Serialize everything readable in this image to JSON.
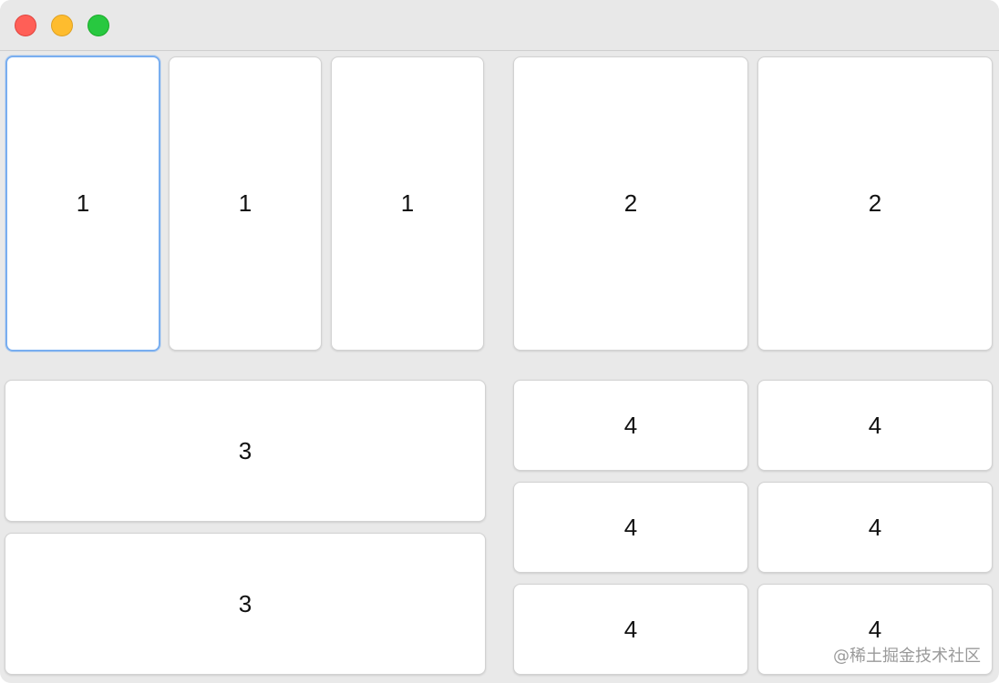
{
  "window": {
    "controls": {
      "close": "close",
      "minimize": "minimize",
      "maximize": "maximize"
    },
    "colors": {
      "close": "#ff5f57",
      "minimize": "#febc2e",
      "maximize": "#28c840",
      "focus_ring": "#79aef0"
    }
  },
  "group1": {
    "cards": [
      "1",
      "1",
      "1"
    ]
  },
  "group2": {
    "cards": [
      "2",
      "2"
    ]
  },
  "group3": {
    "cards": [
      "3",
      "3"
    ]
  },
  "group4": {
    "cards": [
      "4",
      "4",
      "4",
      "4",
      "4",
      "4"
    ]
  },
  "watermark": "@稀土掘金技术社区"
}
